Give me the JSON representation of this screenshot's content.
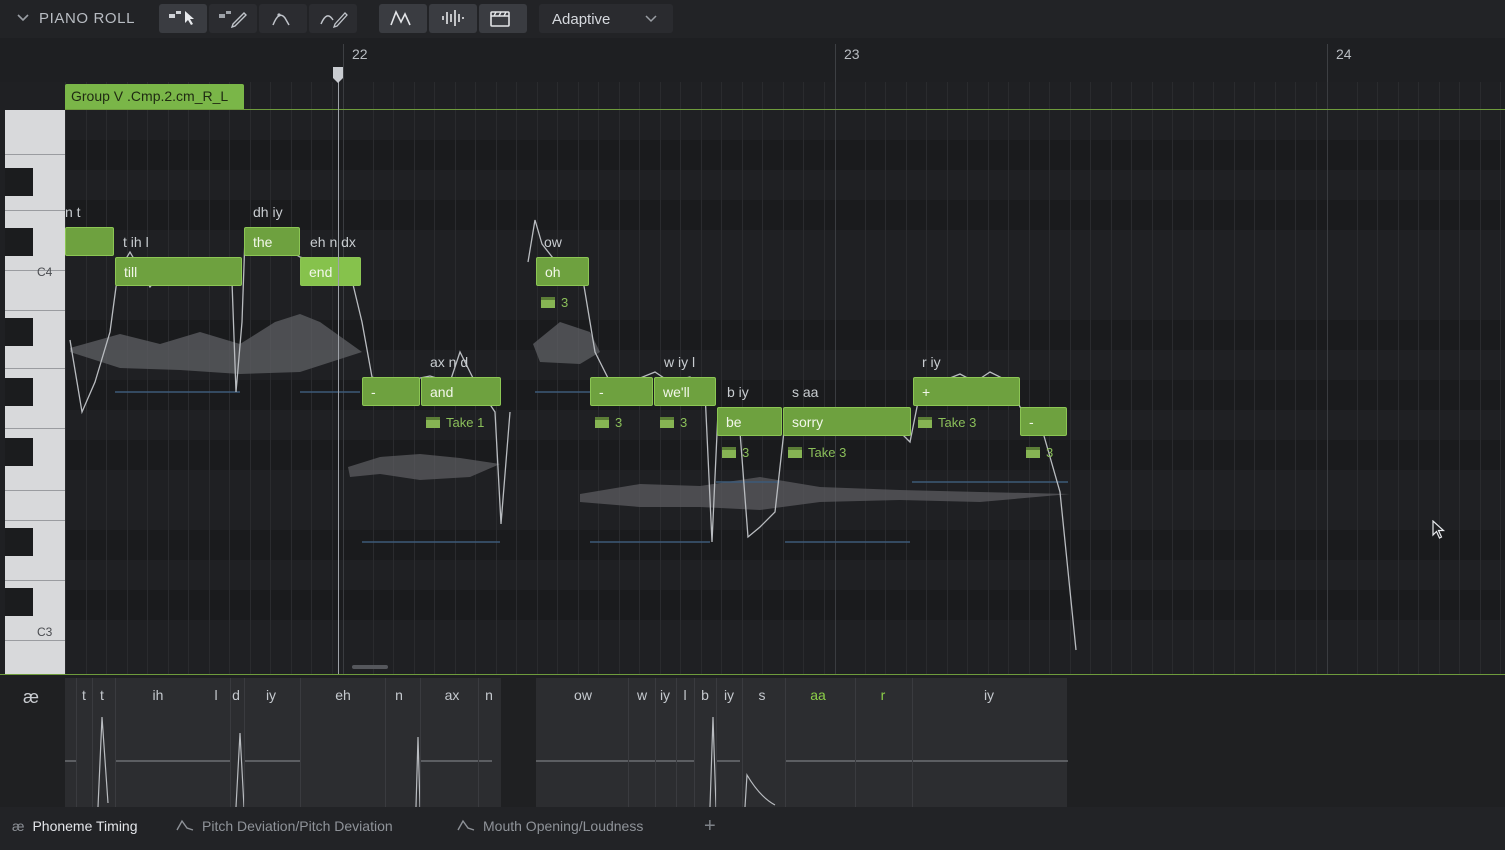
{
  "toolbar": {
    "title": "PIANO ROLL",
    "mode": "Adaptive"
  },
  "ruler": {
    "bars": [
      "22",
      "23",
      "24"
    ]
  },
  "group": {
    "label": "Group V .Cmp.2.cm_R_L"
  },
  "keys": {
    "c4": "C4",
    "c3": "C3"
  },
  "notes": [
    {
      "text": "",
      "phon": "n t"
    },
    {
      "text": "till",
      "phon": "t ih l"
    },
    {
      "text": "the",
      "phon": "dh iy"
    },
    {
      "text": "end",
      "phon": "eh n dx"
    },
    {
      "text": "oh",
      "phon": "ow"
    },
    {
      "text": "-",
      "phon": ""
    },
    {
      "text": "and",
      "phon": "ax n d"
    },
    {
      "text": "-",
      "phon": ""
    },
    {
      "text": "we'll",
      "phon": "w iy l"
    },
    {
      "text": "be",
      "phon": "b iy"
    },
    {
      "text": "sorry",
      "phon": "s aa"
    },
    {
      "text": "+",
      "phon": "r iy"
    },
    {
      "text": "-",
      "phon": ""
    }
  ],
  "takes": [
    "3",
    "Take 1",
    "3",
    "3",
    "3",
    "Take 3",
    "Take 3",
    "3"
  ],
  "phonemes": [
    "t",
    "t",
    "ih",
    "l",
    "d",
    "iy",
    "eh",
    "n",
    "ax",
    "n",
    "ow",
    "w",
    "iy",
    "l",
    "b",
    "iy",
    "s",
    "aa",
    "r",
    "iy"
  ],
  "tabs": [
    {
      "label": "Phoneme Timing",
      "icon": "ae-icon"
    },
    {
      "label": "Pitch Deviation/Pitch Deviation",
      "icon": "curve-icon"
    },
    {
      "label": "Mouth Opening/Loudness",
      "icon": "curve-icon"
    }
  ],
  "add_tab": "+",
  "colors": {
    "note": "#6ea13f",
    "accent": "#8cc654",
    "background": "#1f2023"
  }
}
